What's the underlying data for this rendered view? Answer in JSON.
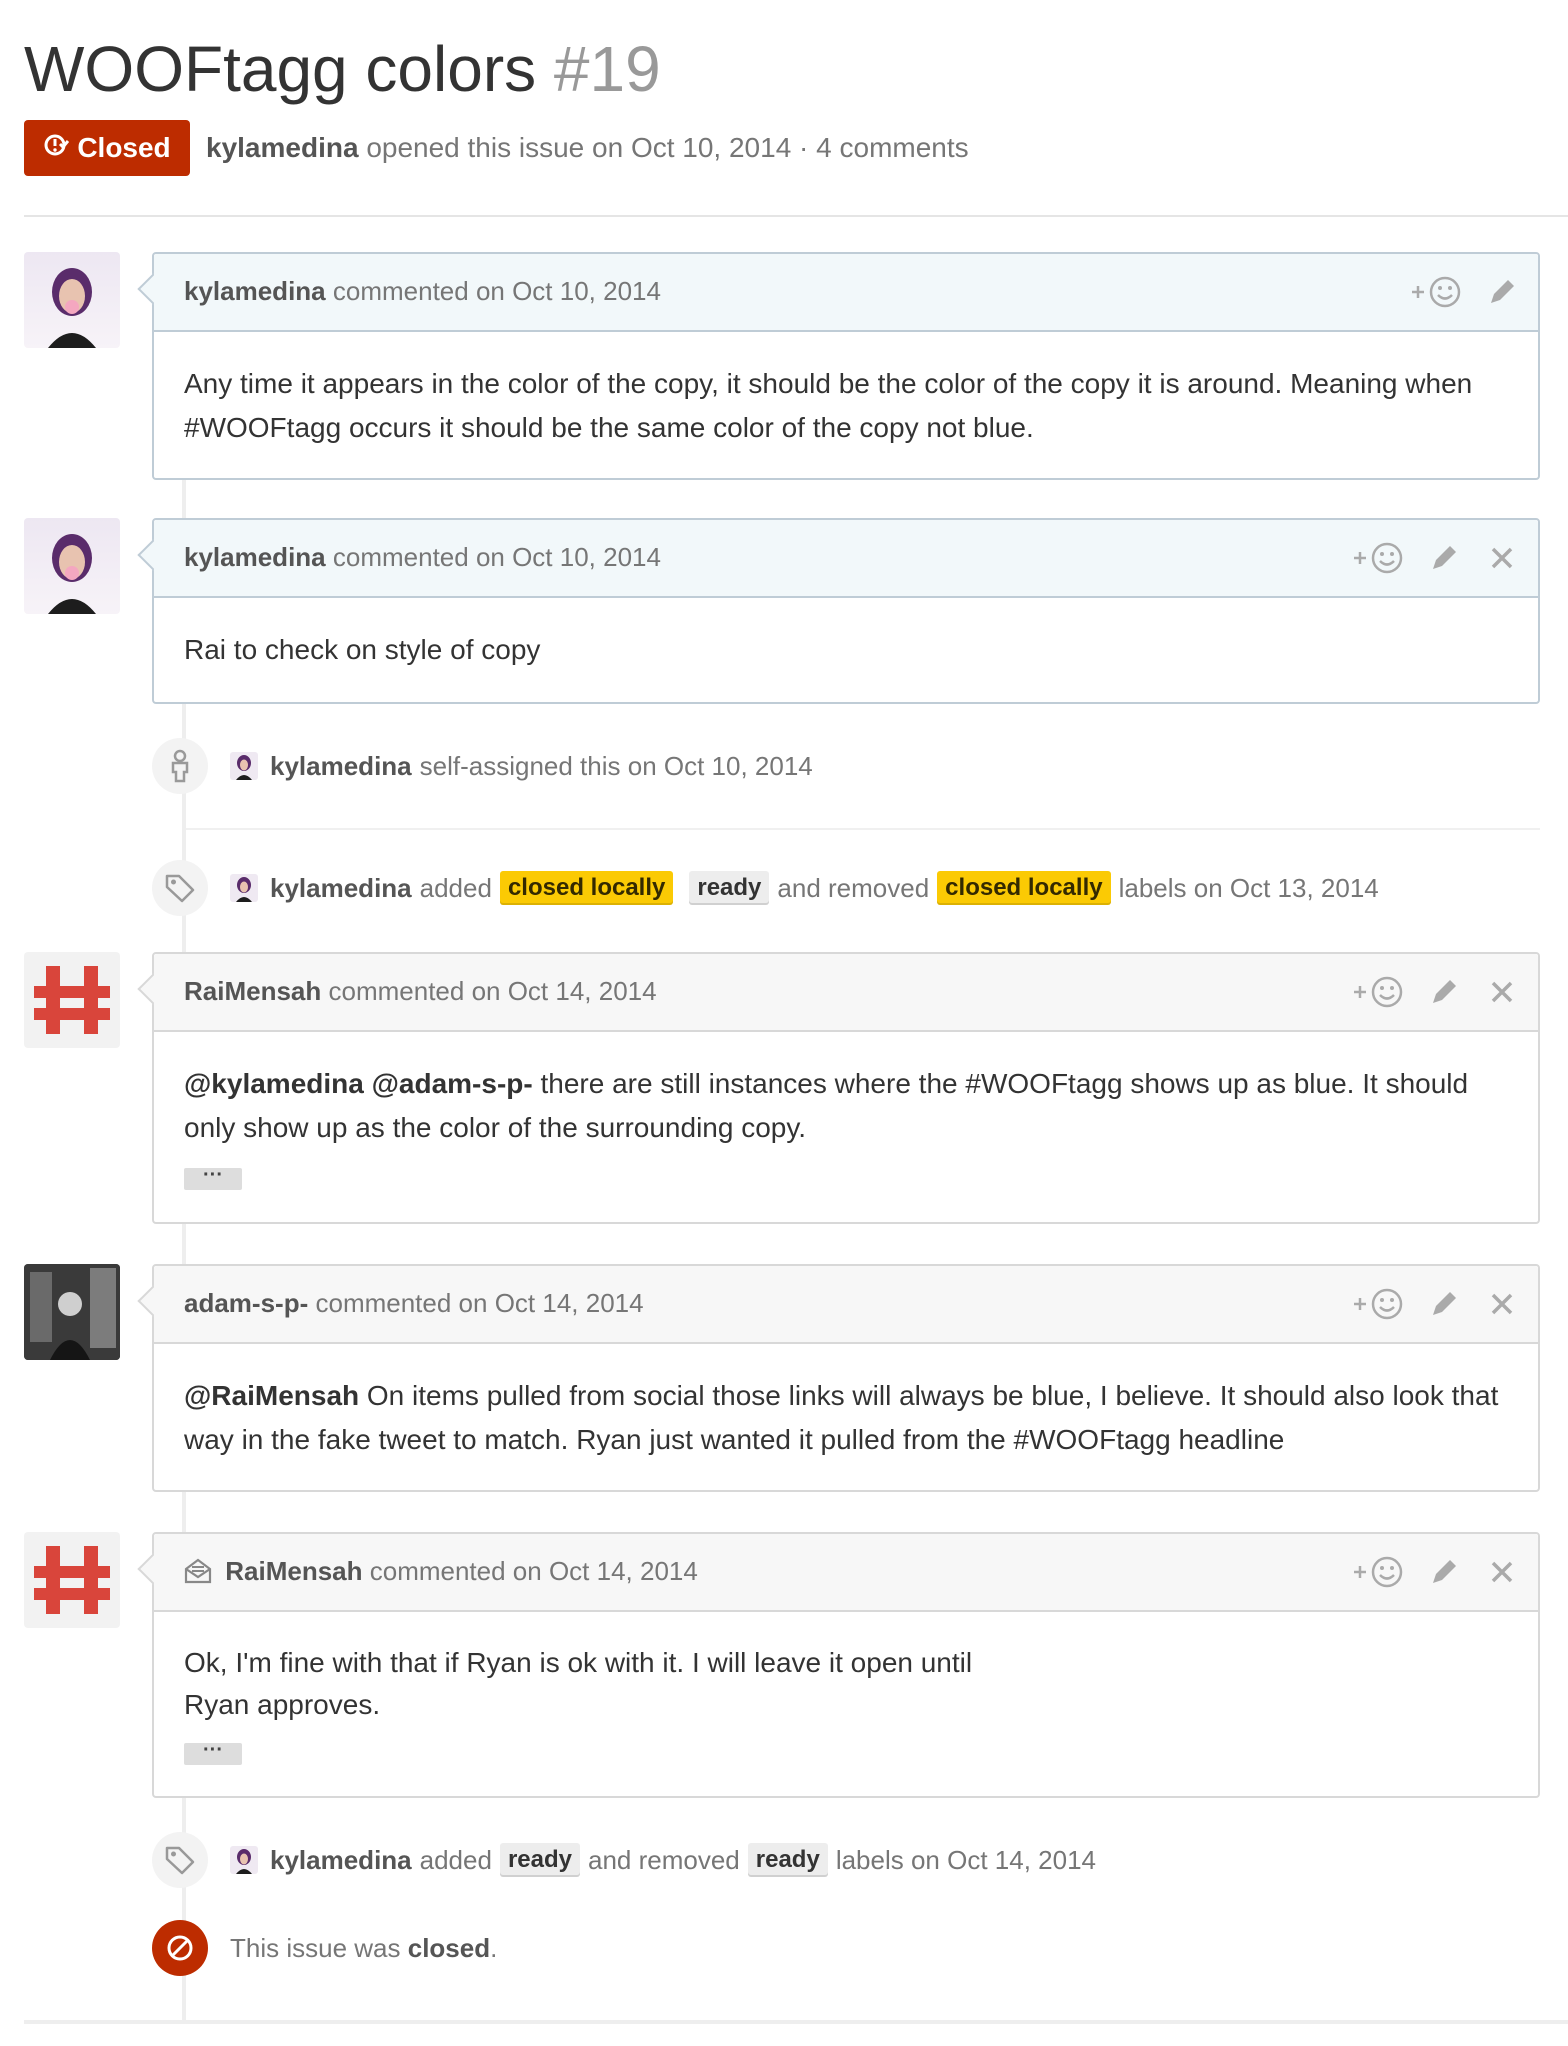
{
  "issue": {
    "title": "WOOFtagg colors",
    "number": "#19",
    "state": "Closed",
    "author": "kylamedina",
    "meta_text": "opened this issue on Oct 10, 2014 · 4 comments"
  },
  "colors": {
    "closed_red": "#bd2c00",
    "label_yellow": "#fbca04",
    "label_gray": "#ededed"
  },
  "comments": [
    {
      "author": "kylamedina",
      "when": "commented on Oct 10, 2014",
      "body_line1": "Any time it appears in the color of the copy, it should be the color of the copy it is around. Meaning when",
      "body_line2": "#WOOFtagg occurs it should be the same color of the copy not blue."
    },
    {
      "author": "kylamedina",
      "when": "commented on Oct 10, 2014",
      "body_line1": "Rai to check on style of copy"
    },
    {
      "author": "RaiMensah",
      "when": "commented on Oct 14, 2014",
      "mention1": "@kylamedina",
      "mention2": "@adam-s-p-",
      "body_line1": "there are still instances where the #WOOFtagg shows up as blue. It should",
      "body_line2": "only show up as the color of the surrounding copy.",
      "more": "···"
    },
    {
      "author": "adam-s-p-",
      "when": "commented on Oct 14, 2014",
      "mention1": "@RaiMensah",
      "body_line1": "On items pulled from social those links will always be blue, I believe. It should also look that",
      "body_line2": "way in the fake tweet to match. Ryan just wanted it pulled from the #WOOFtagg headline"
    },
    {
      "author": "RaiMensah",
      "when": "commented on Oct 14, 2014",
      "body_line1": "Ok, I'm fine with that if Ryan is ok with it. I will leave it open until",
      "body_line2": "Ryan approves.",
      "more": "···"
    }
  ],
  "events": {
    "assigned": {
      "actor": "kylamedina",
      "text": "self-assigned this on Oct 10, 2014"
    },
    "labels1": {
      "actor": "kylamedina",
      "added": "added",
      "label_a": "closed locally",
      "label_b": "ready",
      "and_removed": "and removed",
      "label_c": "closed locally",
      "tail": "labels on Oct 13, 2014"
    },
    "labels2": {
      "actor": "kylamedina",
      "added": "added",
      "label_a": "ready",
      "and_removed": "and removed",
      "label_b": "ready",
      "tail": "labels on Oct 14, 2014"
    },
    "closed": {
      "prefix": "This issue was",
      "state": "closed",
      "suffix": "."
    }
  },
  "icons": {
    "state": "issue-closed-icon",
    "reaction": "add-reaction-icon",
    "edit": "pencil-icon",
    "delete": "close-icon",
    "assign": "person-icon",
    "label": "tag-icon",
    "email": "email-icon",
    "closed": "circle-slash-icon"
  }
}
